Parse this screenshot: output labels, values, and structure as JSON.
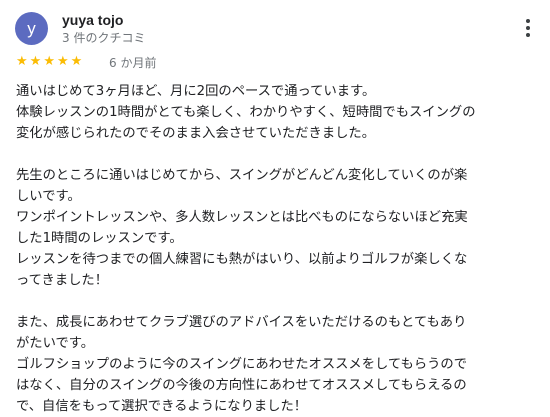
{
  "reviewer": {
    "avatar_letter": "y",
    "avatar_color": "#5c6bc0",
    "name": "yuya tojo",
    "review_count": "3 件のクチコミ"
  },
  "rating": {
    "stars": 5,
    "max": 5,
    "star_color": "#fbbc04"
  },
  "date": "6 か月前",
  "review_paragraphs": [
    [
      "通いはじめて3ヶ月ほど、月に2回のペースで通っています。",
      "体験レッスンの1時間がとても楽しく、わかりやすく、短時間でもスイングの",
      "変化が感じられたのでそのまま入会させていただきました。"
    ],
    [
      "先生のところに通いはじめてから、スイングがどんどん変化していくのが楽",
      "しいです。",
      "ワンポイントレッスンや、多人数レッスンとは比べものにならないほど充実",
      "した1時間のレッスンです。",
      "レッスンを待つまでの個人練習にも熱がはいり、以前よりゴルフが楽しくな",
      "ってきました！"
    ],
    [
      "また、成長にあわせてクラブ選びのアドバイスをいただけるのもとてもあり",
      "がたいです。",
      "ゴルフショップのように今のスイングにあわせたオススメをしてもらうので",
      "はなく、自分のスイングの今後の方向性にあわせてオススメしてもらえるの",
      "で、自信をもって選択できるようになりました！"
    ]
  ]
}
